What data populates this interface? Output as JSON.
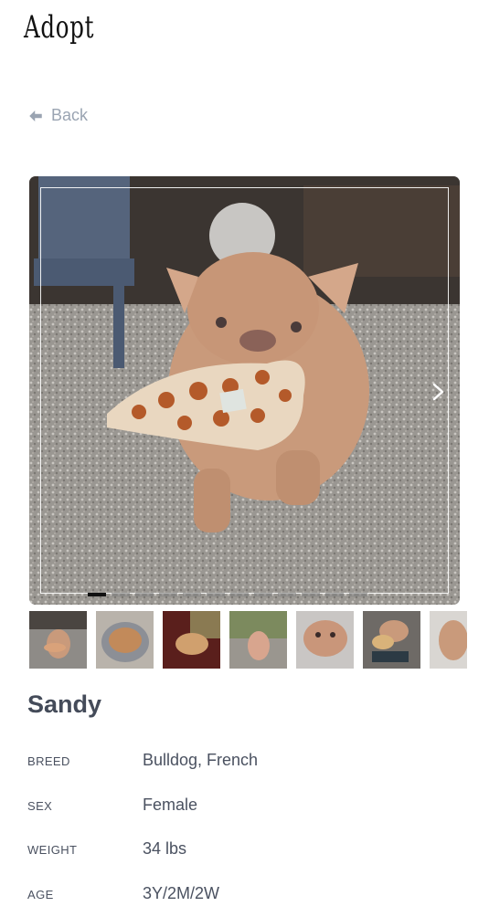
{
  "brand": "Adopt",
  "nav": {
    "back_label": "Back"
  },
  "gallery": {
    "image_count": 12,
    "active_index": 0,
    "thumbnail_count": 7
  },
  "pet": {
    "name": "Sandy",
    "details": [
      {
        "label": "BREED",
        "value": "Bulldog, French"
      },
      {
        "label": "SEX",
        "value": "Female"
      },
      {
        "label": "WEIGHT",
        "value": "34 lbs"
      },
      {
        "label": "AGE",
        "value": "3Y/2M/2W"
      }
    ]
  },
  "colors": {
    "label_text": "#4a5160",
    "back_text": "#9aa4b2",
    "active_dot": "#111111",
    "dog_fur": "#c99a7b"
  }
}
